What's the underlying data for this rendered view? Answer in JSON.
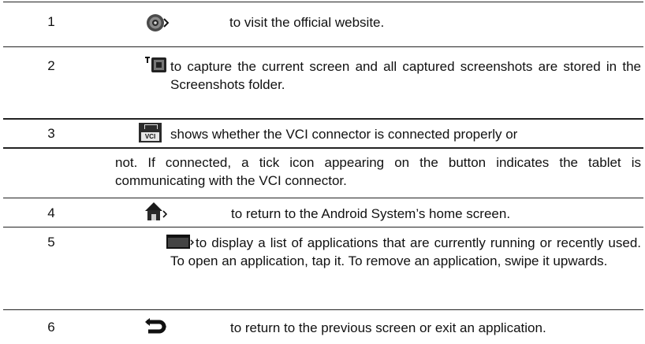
{
  "rows": [
    {
      "num": "1",
      "icon": "browser-icon",
      "text": "to visit the official website."
    },
    {
      "num": "2",
      "icon": "screenshot-icon",
      "text": "to capture the current screen and all captured screenshots are stored in the Screenshots folder."
    },
    {
      "num": "3",
      "icon": "vci-icon",
      "icon_label": "VCI",
      "text_first": "shows whether the VCI connector is connected properly or",
      "text_rest": "not. If connected, a tick icon appearing on the button indicates the tablet is communicating with the VCI connector."
    },
    {
      "num": "4",
      "icon": "home-icon",
      "text": "to return to the Android System’s home screen."
    },
    {
      "num": "5",
      "icon": "recent-apps-icon",
      "text": "to display a list of applications that are currently running or recently used. To open an application, tap it. To remove an application, swipe it upwards."
    },
    {
      "num": "6",
      "icon": "back-icon",
      "text": "to return to the previous screen or exit an application."
    }
  ]
}
